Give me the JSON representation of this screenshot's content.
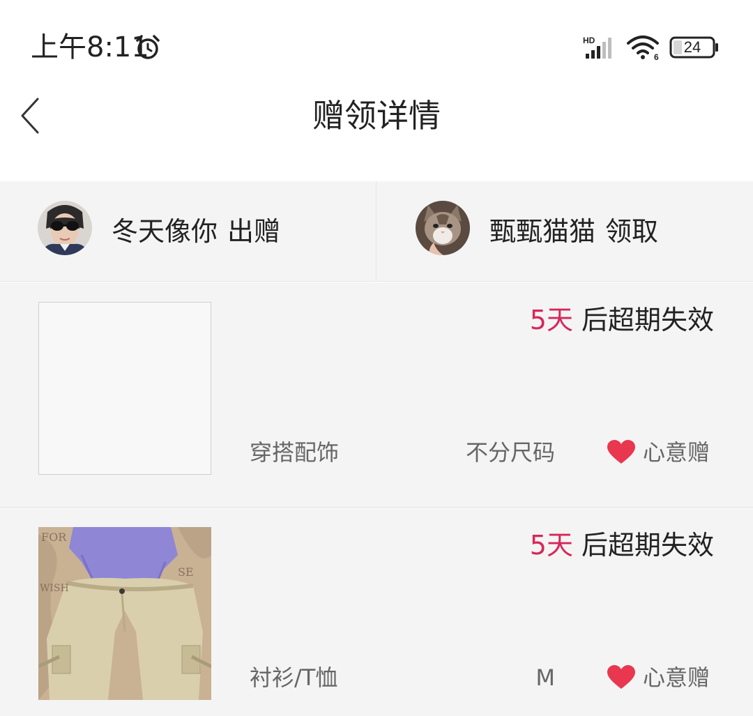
{
  "status_bar": {
    "time": "上午8:11",
    "battery": "24",
    "icons": [
      "alarm-icon",
      "hd-signal-icon",
      "wifi-6-icon",
      "battery-icon"
    ]
  },
  "header": {
    "title": "赠领详情",
    "back_icon": "chevron-left-icon"
  },
  "users": {
    "giver": {
      "name": "冬天像你",
      "action": "出赠"
    },
    "receiver": {
      "name": "甄甄猫猫",
      "action": "领取"
    }
  },
  "items": [
    {
      "expiry_days": "5天",
      "expiry_suffix": "后超期失效",
      "category": "穿搭配饰",
      "size": "不分尺码",
      "gift_type": "心意赠"
    },
    {
      "expiry_days": "5天",
      "expiry_suffix": "后超期失效",
      "category": "衬衫/T恤",
      "size": "M",
      "gift_type": "心意赠"
    }
  ],
  "colors": {
    "accent": "#d7275a",
    "heart": "#e8374f",
    "background": "#f4f4f4"
  }
}
